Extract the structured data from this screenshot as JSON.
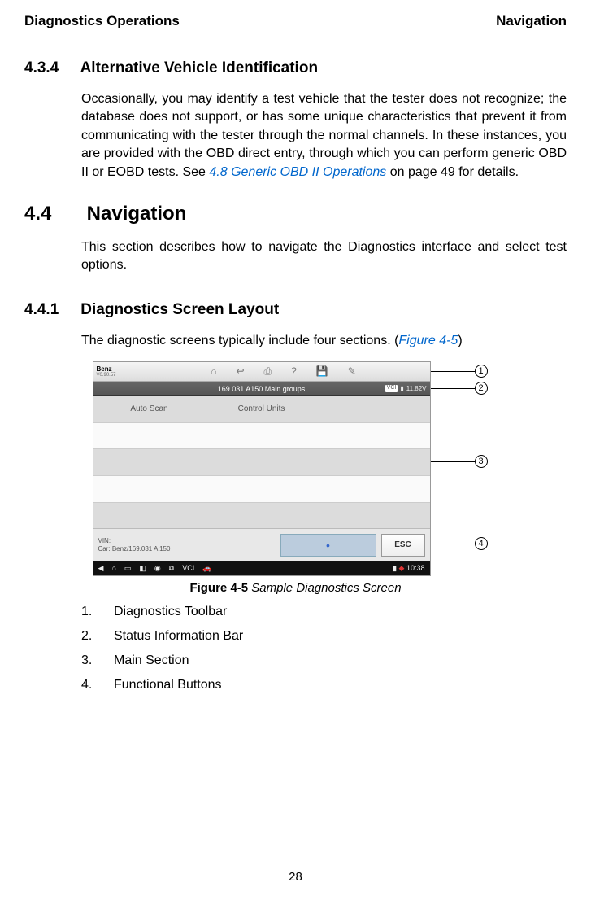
{
  "header": {
    "left": "Diagnostics Operations",
    "right": "Navigation"
  },
  "s434": {
    "num": "4.3.4",
    "title": "Alternative Vehicle Identification",
    "body_pre": "Occasionally, you may identify a test vehicle that the tester does not recognize; the database does not support, or has some unique characteristics that prevent it from communicating with the tester through the normal channels. In these instances, you are provided with the OBD direct entry, through which you can perform generic OBD II or EOBD tests. See ",
    "body_link": "4.8 Generic OBD II Operations",
    "body_post": " on page 49 for details."
  },
  "s44": {
    "num": "4.4",
    "title": "Navigation",
    "body": "This section describes how to navigate the Diagnostics interface and select test options."
  },
  "s441": {
    "num": "4.4.1",
    "title": "Diagnostics Screen Layout",
    "intro_pre": "The diagnostic screens typically include four sections. (",
    "intro_link": "Figure 4-5",
    "intro_post": ")"
  },
  "figure": {
    "brand": "Benz",
    "brand_sub": "V0.90.57",
    "status_title": "169.031 A150 Main groups",
    "vci_label": "VCI",
    "battery": "11.82V",
    "auto_scan": "Auto Scan",
    "control_units": "Control Units",
    "vin_label": "VIN:",
    "car_label": "Car: Benz/169.031 A 150",
    "blue_dot": "•",
    "esc": "ESC",
    "vci_text": "VCI",
    "time": "10:38",
    "caption_bold": "Figure 4-5",
    "caption_italic": " Sample Diagnostics Screen",
    "callouts": {
      "c1": "1",
      "c2": "2",
      "c3": "3",
      "c4": "4"
    }
  },
  "list": {
    "i1": {
      "n": "1.",
      "t": "Diagnostics Toolbar"
    },
    "i2": {
      "n": "2.",
      "t": "Status Information Bar"
    },
    "i3": {
      "n": "3.",
      "t": "Main Section"
    },
    "i4": {
      "n": "4.",
      "t": "Functional Buttons"
    }
  },
  "page_number": "28"
}
